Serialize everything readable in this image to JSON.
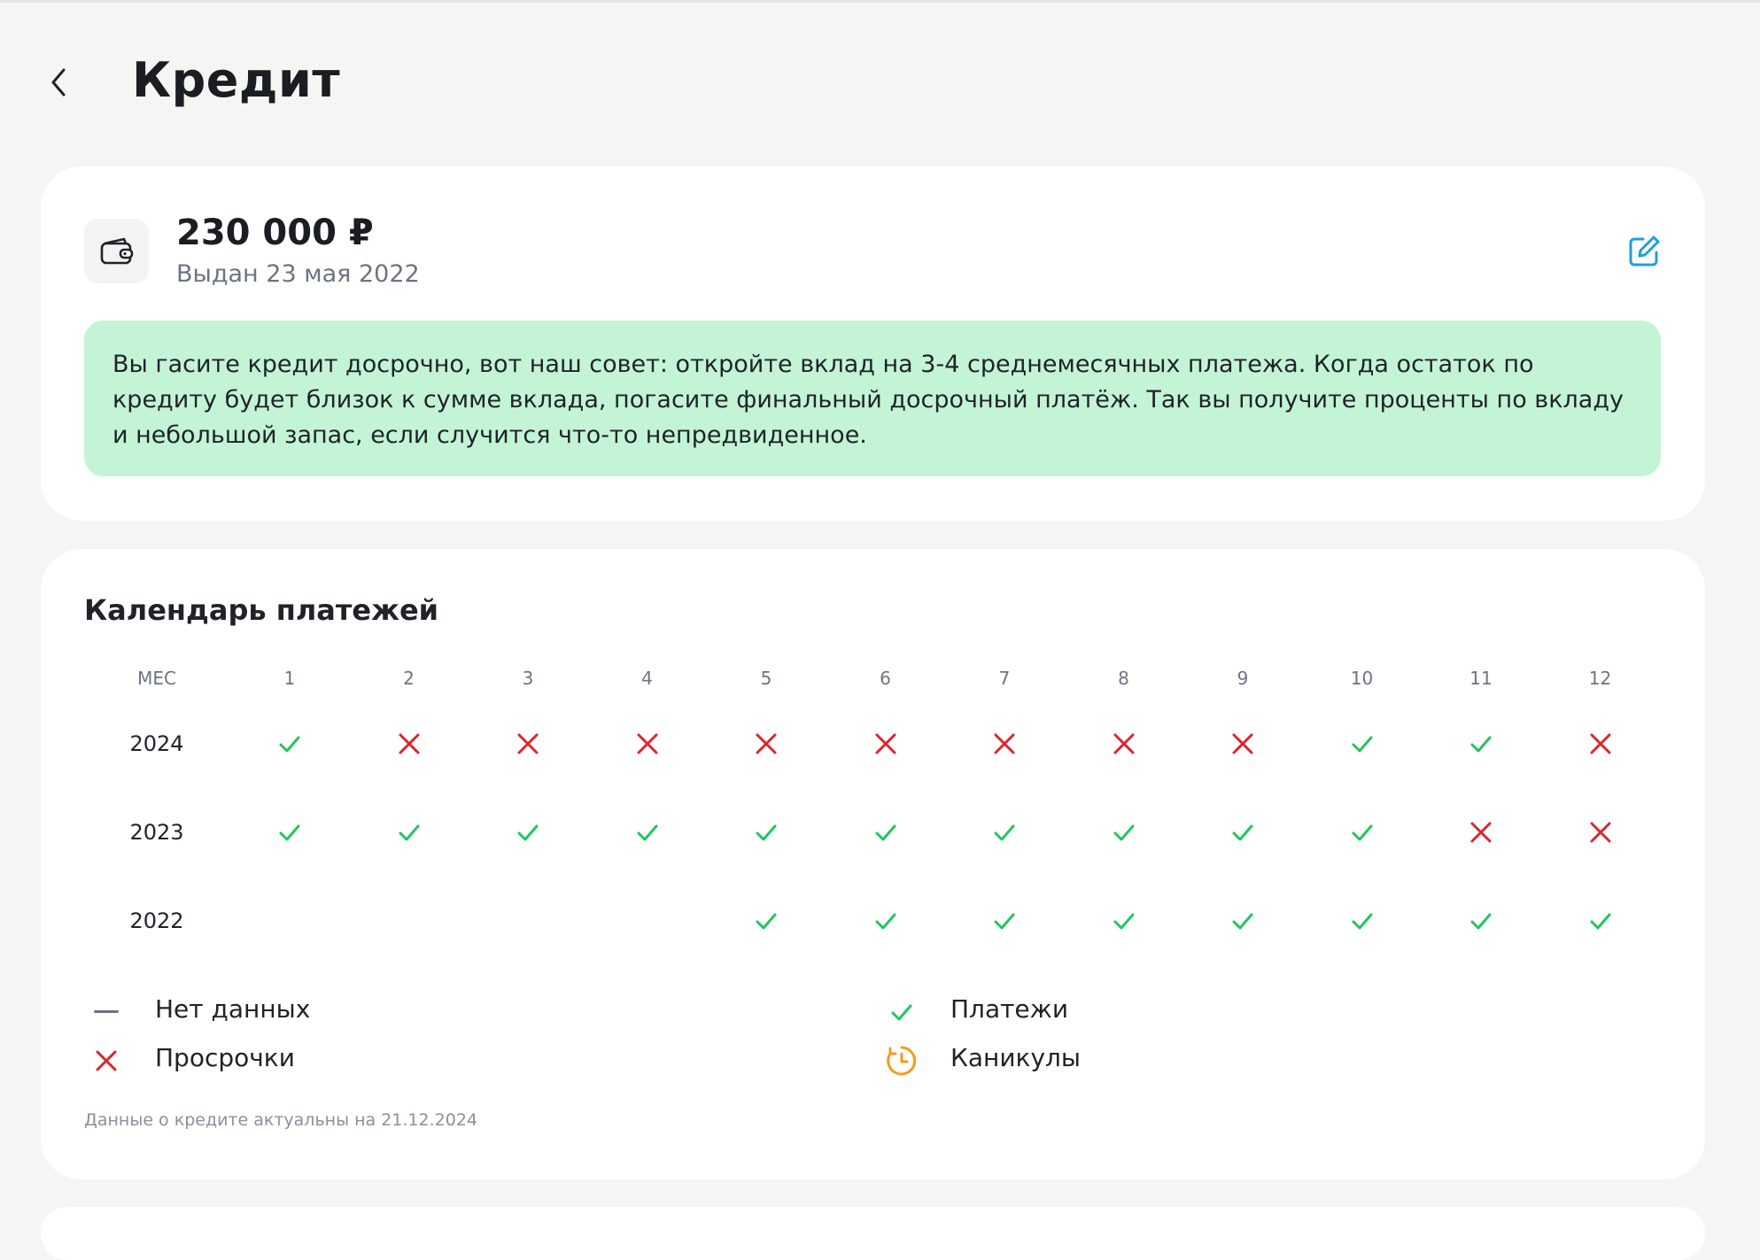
{
  "header": {
    "title": "Кредит"
  },
  "loan": {
    "amount": "230 000 ₽",
    "issued": "Выдан 23 мая 2022",
    "advice": "Вы гасите кредит досрочно, вот наш совет: откройте вклад на 3-4 среднемесячных платежа. Когда остаток по кредиту будет близок к сумме вклада, погасите финальный досрочный платёж. Так вы получите проценты по вкладу и небольшой запас, если случится что-то непредвиденное."
  },
  "calendar": {
    "title": "Календарь платежей",
    "month_header": "МЕС",
    "months": [
      "1",
      "2",
      "3",
      "4",
      "5",
      "6",
      "7",
      "8",
      "9",
      "10",
      "11",
      "12"
    ],
    "rows": [
      {
        "year": "2024",
        "statuses": [
          "paid",
          "overdue",
          "overdue",
          "overdue",
          "overdue",
          "overdue",
          "overdue",
          "overdue",
          "overdue",
          "paid",
          "paid",
          "overdue"
        ]
      },
      {
        "year": "2023",
        "statuses": [
          "paid",
          "paid",
          "paid",
          "paid",
          "paid",
          "paid",
          "paid",
          "paid",
          "paid",
          "paid",
          "overdue",
          "overdue"
        ]
      },
      {
        "year": "2022",
        "statuses": [
          "",
          "",
          "",
          "",
          "paid",
          "paid",
          "paid",
          "paid",
          "paid",
          "paid",
          "paid",
          "paid"
        ]
      }
    ],
    "legend": {
      "no_data": "Нет данных",
      "payments": "Платежи",
      "overdue": "Просрочки",
      "holidays": "Каникулы"
    },
    "footnote": "Данные о кредите актуальны на 21.12.2024"
  },
  "icons": {
    "back": "chevron-left-icon",
    "wallet": "wallet-icon",
    "edit": "edit-icon",
    "paid": "check-icon",
    "overdue": "cross-icon",
    "no_data": "dash-icon",
    "holidays": "clock-icon"
  },
  "colors": {
    "paid": "#22c55e",
    "overdue": "#d9262c",
    "holidays": "#f59c1a",
    "edit": "#1aa0e0",
    "advice_bg": "#c3f4d6"
  }
}
